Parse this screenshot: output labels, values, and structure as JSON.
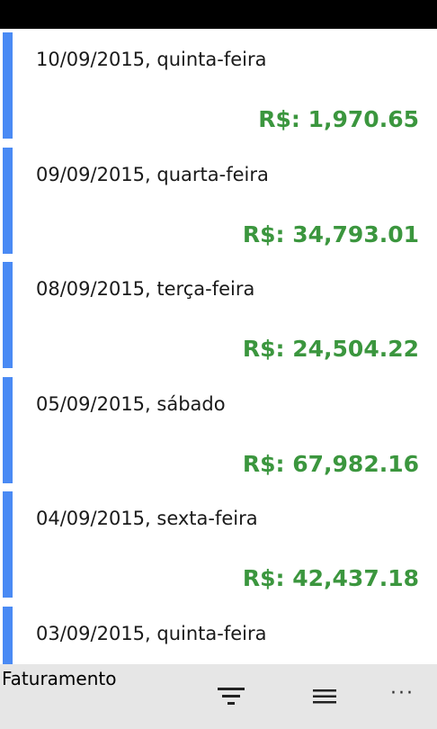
{
  "days": [
    {
      "date": "10/09/2015, quinta-feira",
      "amount": "R$: 1,970.65"
    },
    {
      "date": "09/09/2015, quarta-feira",
      "amount": "R$: 34,793.01"
    },
    {
      "date": "08/09/2015, terça-feira",
      "amount": "R$: 24,504.22"
    },
    {
      "date": "05/09/2015, sábado",
      "amount": "R$: 67,982.16"
    },
    {
      "date": "04/09/2015, sexta-feira",
      "amount": "R$: 42,437.18"
    },
    {
      "date": "03/09/2015, quinta-feira",
      "amount": ""
    }
  ],
  "app_bar": {
    "title": "Faturamento",
    "more_label": "···"
  },
  "colors": {
    "accent": "#4a8af4",
    "amount": "#3b963e",
    "app_bar_bg": "#e6e6e6",
    "status_bar": "#000000"
  },
  "icons": [
    "filter-icon",
    "menu-icon",
    "more-icon"
  ]
}
